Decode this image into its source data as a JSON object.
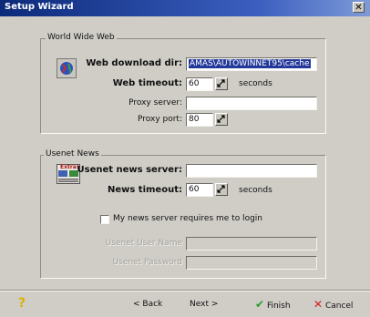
{
  "window": {
    "title": "Setup Wizard",
    "close_glyph": "✕"
  },
  "web_group": {
    "title": "World Wide Web",
    "icon": "globe-icon",
    "download_dir": {
      "label": "Web download dir:",
      "value": "AMAS\\AUTOWINNET95\\cache"
    },
    "timeout": {
      "label": "Web timeout:",
      "value": "60",
      "unit": "seconds"
    },
    "proxy_server": {
      "label": "Proxy server:",
      "value": ""
    },
    "proxy_port": {
      "label": "Proxy port:",
      "value": "80"
    }
  },
  "news_group": {
    "title": "Usenet News",
    "icon": "newspaper-icon",
    "icon_text": "Extra!",
    "server": {
      "label": "Usenet news server:",
      "value": ""
    },
    "timeout": {
      "label": "News timeout:",
      "value": "60",
      "unit": "seconds"
    },
    "login_checkbox": {
      "label": "My news server requires me to login",
      "checked": false
    },
    "user_name": {
      "label": "Usenet User Name",
      "value": ""
    },
    "password": {
      "label": "Usenet Password",
      "value": ""
    }
  },
  "footer": {
    "help_glyph": "?",
    "back_label": "< Back",
    "next_label": "Next >",
    "finish_label": "Finish",
    "cancel_label": "Cancel",
    "colors": {
      "finish_check": "#2a9a2a",
      "cancel_x": "#d02020",
      "help": "#d8b400"
    }
  }
}
